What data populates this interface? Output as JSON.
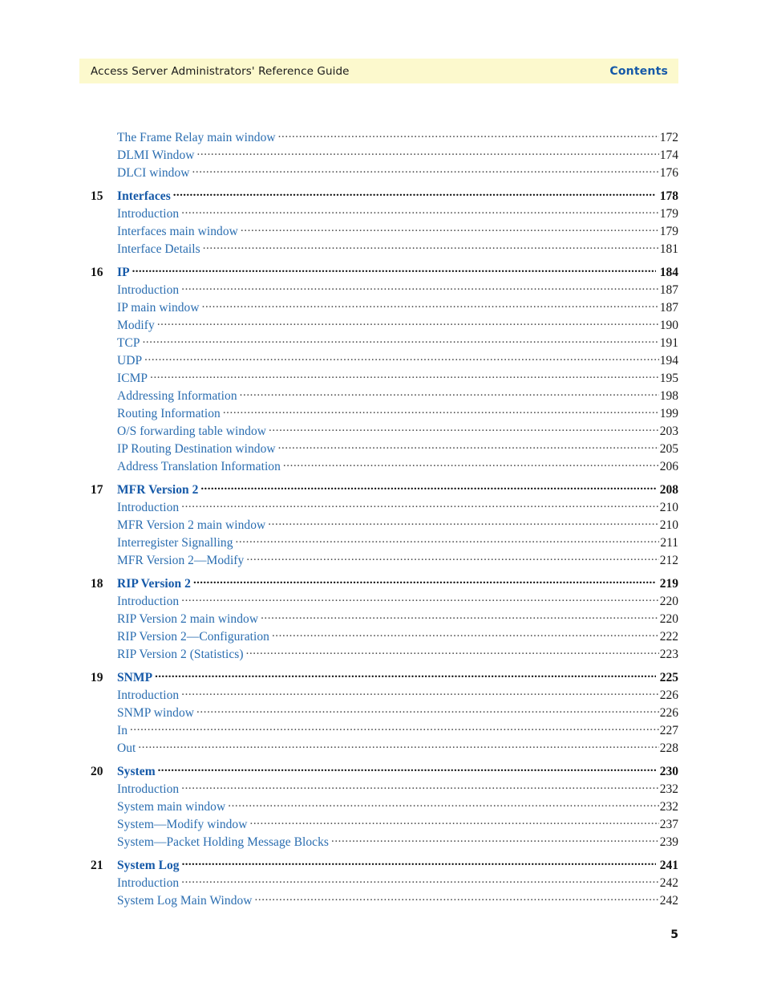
{
  "header": {
    "title": "Access Server Administrators' Reference Guide",
    "section": "Contents"
  },
  "folio": {
    "page_number": "5"
  },
  "colors": {
    "header_band_bg": "#fcf9cd",
    "header_section_blue": "#1559a8",
    "chapter_title_blue": "#1559a8",
    "subentry_blue": "#2a6db0",
    "page_number_black": "#111111"
  },
  "toc": {
    "entries": [
      {
        "type": "sub",
        "number": "",
        "label": "The Frame Relay main window",
        "page": "172"
      },
      {
        "type": "sub",
        "number": "",
        "label": "DLMI Window",
        "page": "174"
      },
      {
        "type": "sub",
        "number": "",
        "label": "DLCI window",
        "page": "176"
      },
      {
        "type": "chapter",
        "number": "15",
        "label": "Interfaces",
        "page": "178"
      },
      {
        "type": "sub",
        "number": "",
        "label": "Introduction",
        "page": "179"
      },
      {
        "type": "sub",
        "number": "",
        "label": "Interfaces main window",
        "page": "179"
      },
      {
        "type": "sub",
        "number": "",
        "label": "Interface Details",
        "page": "181"
      },
      {
        "type": "chapter",
        "number": "16",
        "label": "IP",
        "page": "184"
      },
      {
        "type": "sub",
        "number": "",
        "label": "Introduction",
        "page": "187"
      },
      {
        "type": "sub",
        "number": "",
        "label": "IP main window",
        "page": "187"
      },
      {
        "type": "sub",
        "number": "",
        "label": "Modify",
        "page": "190"
      },
      {
        "type": "sub",
        "number": "",
        "label": "TCP",
        "page": "191"
      },
      {
        "type": "sub",
        "number": "",
        "label": "UDP",
        "page": "194"
      },
      {
        "type": "sub",
        "number": "",
        "label": "ICMP",
        "page": "195"
      },
      {
        "type": "sub",
        "number": "",
        "label": "Addressing Information",
        "page": "198"
      },
      {
        "type": "sub",
        "number": "",
        "label": "Routing Information",
        "page": "199"
      },
      {
        "type": "sub",
        "number": "",
        "label": "O/S forwarding table window",
        "page": "203"
      },
      {
        "type": "sub",
        "number": "",
        "label": "IP Routing Destination window",
        "page": "205"
      },
      {
        "type": "sub",
        "number": "",
        "label": "Address Translation Information",
        "page": "206"
      },
      {
        "type": "chapter",
        "number": "17",
        "label": "MFR Version 2",
        "page": "208"
      },
      {
        "type": "sub",
        "number": "",
        "label": "Introduction",
        "page": "210"
      },
      {
        "type": "sub",
        "number": "",
        "label": "MFR Version 2 main window",
        "page": "210"
      },
      {
        "type": "sub",
        "number": "",
        "label": "Interregister Signalling",
        "page": "211"
      },
      {
        "type": "sub",
        "number": "",
        "label": "MFR Version 2—Modify",
        "page": "212"
      },
      {
        "type": "chapter",
        "number": "18",
        "label": "RIP Version 2",
        "page": "219"
      },
      {
        "type": "sub",
        "number": "",
        "label": "Introduction",
        "page": "220"
      },
      {
        "type": "sub",
        "number": "",
        "label": "RIP Version 2 main window",
        "page": "220"
      },
      {
        "type": "sub",
        "number": "",
        "label": "RIP Version 2—Configuration",
        "page": "222"
      },
      {
        "type": "sub",
        "number": "",
        "label": "RIP Version 2 (Statistics)",
        "page": "223"
      },
      {
        "type": "chapter",
        "number": "19",
        "label": "SNMP",
        "page": "225"
      },
      {
        "type": "sub",
        "number": "",
        "label": "Introduction",
        "page": "226"
      },
      {
        "type": "sub",
        "number": "",
        "label": "SNMP window",
        "page": "226"
      },
      {
        "type": "sub",
        "number": "",
        "label": "In",
        "page": "227"
      },
      {
        "type": "sub",
        "number": "",
        "label": "Out",
        "page": "228"
      },
      {
        "type": "chapter",
        "number": "20",
        "label": "System",
        "page": "230"
      },
      {
        "type": "sub",
        "number": "",
        "label": "Introduction",
        "page": "232"
      },
      {
        "type": "sub",
        "number": "",
        "label": "System main window",
        "page": "232"
      },
      {
        "type": "sub",
        "number": "",
        "label": "System—Modify window",
        "page": "237"
      },
      {
        "type": "sub",
        "number": "",
        "label": "System—Packet Holding Message Blocks",
        "page": "239"
      },
      {
        "type": "chapter",
        "number": "21",
        "label": "System Log",
        "page": "241"
      },
      {
        "type": "sub",
        "number": "",
        "label": "Introduction",
        "page": "242"
      },
      {
        "type": "sub",
        "number": "",
        "label": "System Log Main Window",
        "page": "242"
      }
    ]
  }
}
